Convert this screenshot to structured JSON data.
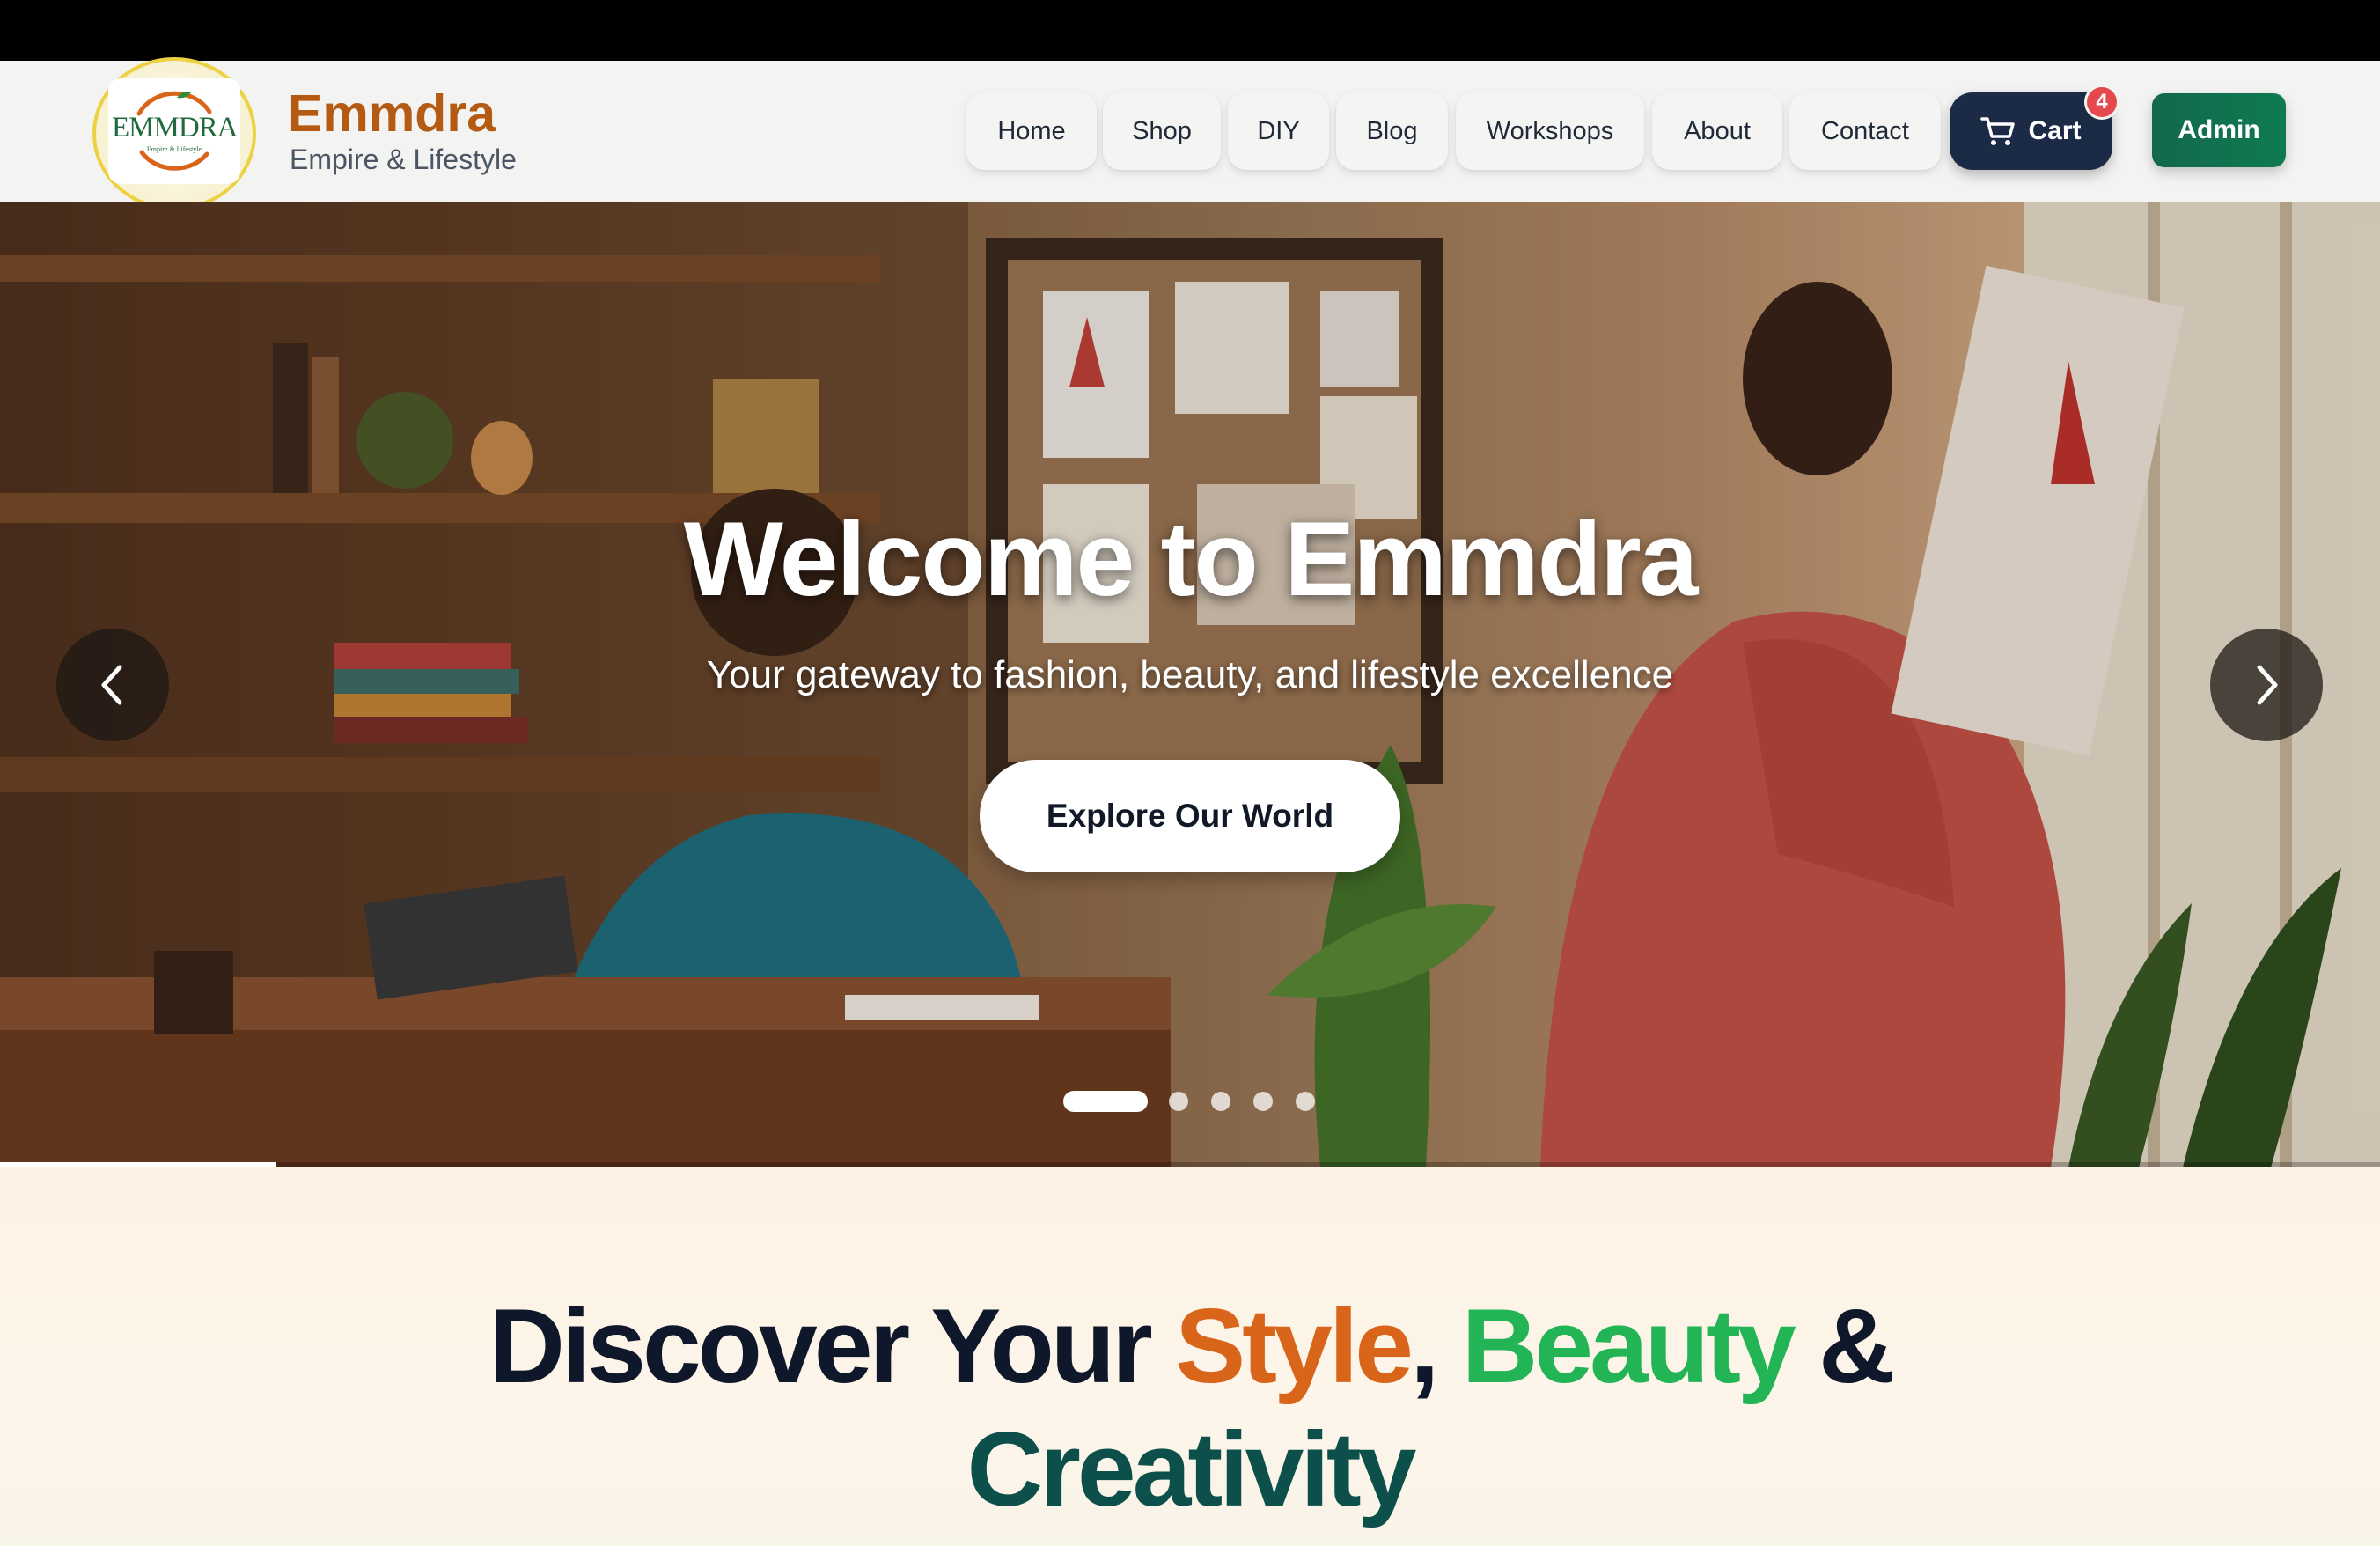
{
  "brand": {
    "logo_text": "EMMDRA",
    "logo_tagline": "Empire & Lifestyle",
    "name": "Emmdra",
    "subtitle": "Empire & Lifestyle"
  },
  "nav": {
    "items": [
      {
        "label": "Home"
      },
      {
        "label": "Shop"
      },
      {
        "label": "DIY"
      },
      {
        "label": "Blog"
      },
      {
        "label": "Workshops"
      },
      {
        "label": "About"
      },
      {
        "label": "Contact"
      }
    ],
    "cart_label": "Cart",
    "cart_count": "4",
    "admin_label": "Admin"
  },
  "hero": {
    "title": "Welcome to Emmdra",
    "subtitle": "Your gateway to fashion, beauty, and lifestyle excellence",
    "cta_label": "Explore Our World",
    "slide_count": 5,
    "active_slide": 1,
    "progress_fraction": 0.2
  },
  "discover": {
    "line1_part1": "Discover Your ",
    "word_style": "Style",
    "comma": ",",
    "word_beauty": "Beauty",
    "ampersand": "&",
    "word_creativity": "Creativity"
  },
  "colors": {
    "brand_orange": "#b45a12",
    "accent_orange": "#d9651a",
    "accent_green": "#22b455",
    "deep_teal": "#0d4f4a",
    "cart_navy": "#1b2a45",
    "admin_green": "#0f7a52",
    "badge_red": "#e5484d"
  },
  "icons": [
    "cart-icon",
    "chevron-left-icon",
    "chevron-right-icon"
  ]
}
